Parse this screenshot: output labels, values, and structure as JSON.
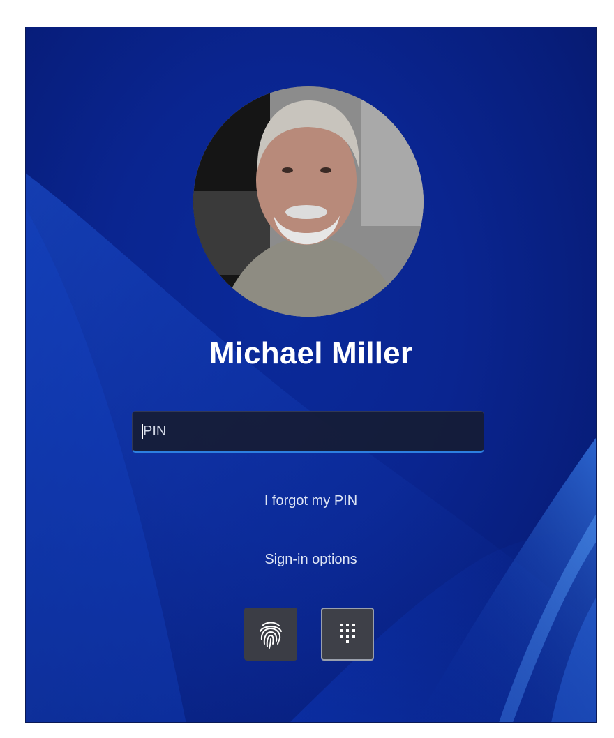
{
  "user": {
    "name": "Michael Miller",
    "avatar_icon": "user-photo"
  },
  "pin_field": {
    "placeholder": "PIN",
    "value": ""
  },
  "links": {
    "forgot_pin": "I forgot my PIN",
    "sign_in_options": "Sign-in options"
  },
  "sign_in_methods": [
    {
      "icon": "fingerprint-icon",
      "selected": false
    },
    {
      "icon": "pin-keypad-icon",
      "selected": true
    }
  ],
  "colors": {
    "background": "#0a2590",
    "input_accent": "#2d7fe0",
    "text": "#ffffff"
  }
}
